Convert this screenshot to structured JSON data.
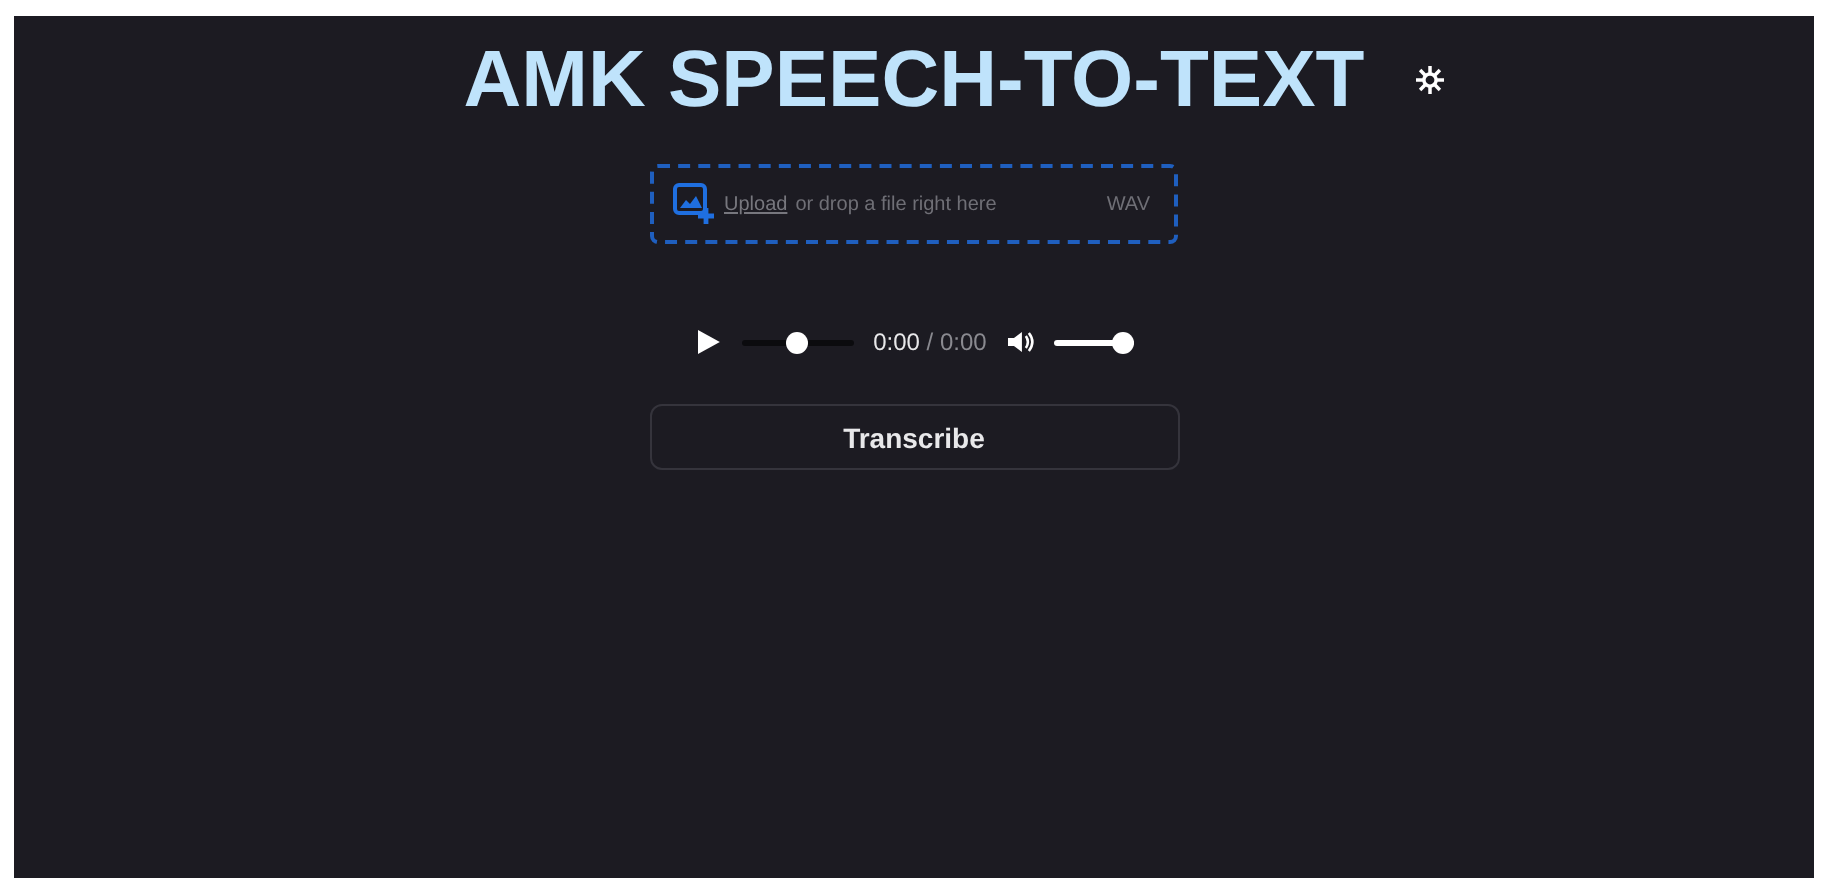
{
  "header": {
    "title": "AMK SPEECH-TO-TEXT"
  },
  "upload": {
    "link": "Upload",
    "text": "or drop a file right here",
    "format": "WAV"
  },
  "player": {
    "seek": {
      "level": 0.5
    },
    "current": "0:00",
    "separator": "/",
    "duration": "0:00",
    "volume": {
      "level": 1
    }
  },
  "buttons": [
    {
      "label": "Transcribe"
    }
  ]
}
